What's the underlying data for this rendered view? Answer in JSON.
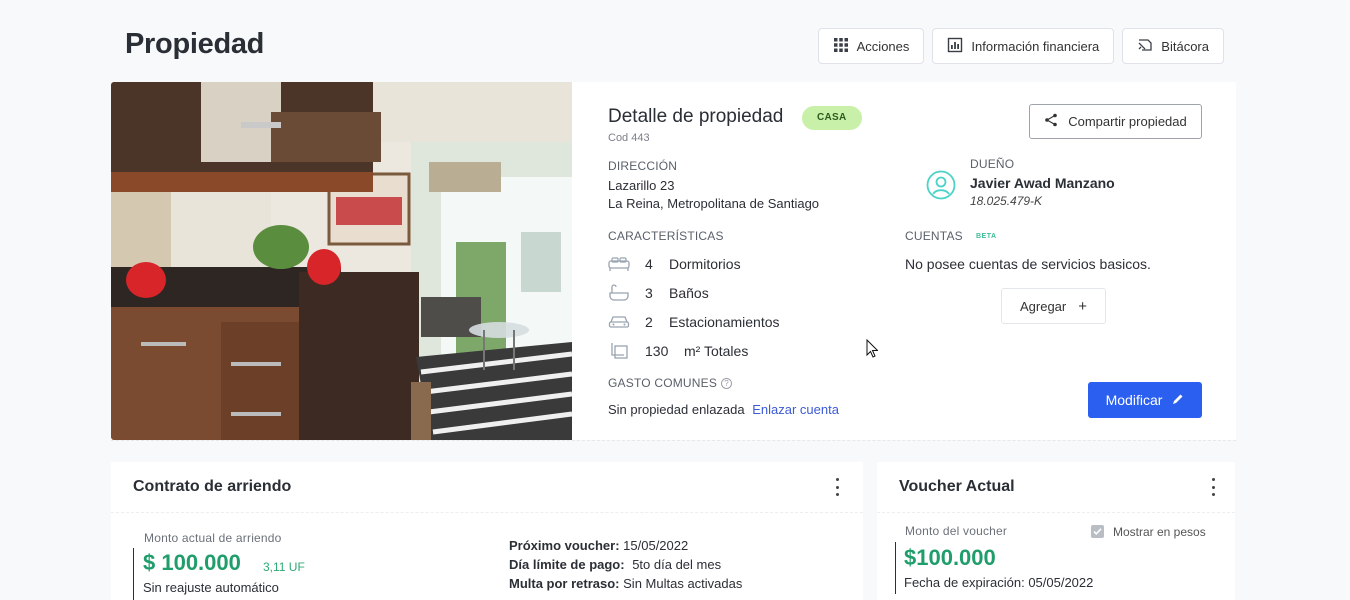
{
  "page": {
    "title": "Propiedad"
  },
  "actions": {
    "acciones": "Acciones",
    "financiera": "Información financiera",
    "bitacora": "Bitácora"
  },
  "property": {
    "title": "Detalle de propiedad",
    "type_tag": "CASA",
    "code": "Cod 443",
    "address_label": "DIRECCIÓN",
    "address_line1": "Lazarillo 23",
    "address_line2": "La Reina, Metropolitana de Santiago",
    "features_label": "CARACTERÍSTICAS",
    "features": [
      {
        "icon": "bed-icon",
        "count": "4",
        "label": "Dormitorios"
      },
      {
        "icon": "bathtub-icon",
        "count": "3",
        "label": "Baños"
      },
      {
        "icon": "car-icon",
        "count": "2",
        "label": "Estacionamientos"
      },
      {
        "icon": "area-icon",
        "count": "130",
        "label": "m² Totales"
      }
    ],
    "common_label": "GASTO COMUNES",
    "common_text": "Sin propiedad enlazada",
    "common_link": "Enlazar cuenta",
    "share_label": "Compartir propiedad",
    "owner_label": "DUEÑO",
    "owner_name": "Javier Awad Manzano",
    "owner_rut": "18.025.479-K",
    "accounts_label": "CUENTAS",
    "accounts_beta": "BETA",
    "accounts_empty": "No posee cuentas de servicios basicos.",
    "add_label": "Agregar",
    "modify_label": "Modificar"
  },
  "contract": {
    "title": "Contrato de arriendo",
    "rent_label": "Monto actual de arriendo",
    "rent_amount": "$ 100.000",
    "rent_uf": "3,11 UF",
    "readjust": "Sin reajuste automático",
    "next_voucher_key": "Próximo voucher:",
    "next_voucher_val": "15/05/2022",
    "pay_limit_key": "Día límite de pago:",
    "pay_limit_val": "5to día del mes",
    "late_key": "Multa por retraso:",
    "late_val": "Sin Multas activadas"
  },
  "voucher": {
    "title": "Voucher Actual",
    "amount_label": "Monto del voucher",
    "show_pesos": "Mostrar en pesos",
    "show_pesos_checked": true,
    "amount": "$100.000",
    "expiry_key": "Fecha de expiración:",
    "expiry_val": "05/05/2022"
  },
  "colors": {
    "primary": "#2b5ff0",
    "accent_green": "#1f9d6a",
    "tag_bg": "#c8f0a8"
  }
}
